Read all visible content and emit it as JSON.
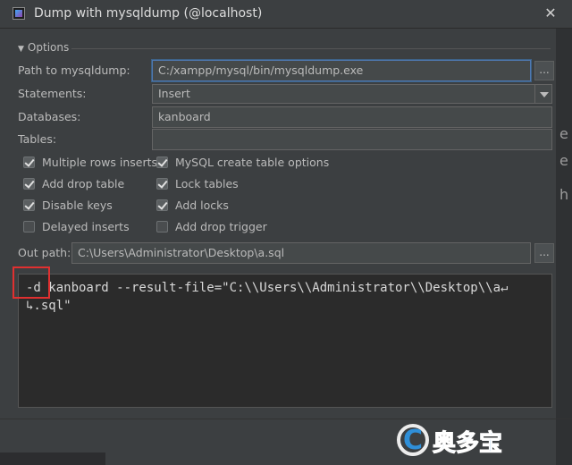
{
  "window": {
    "title": "Dump with mysqldump (@localhost)",
    "close_glyph": "✕"
  },
  "right_strip_chars": [
    "e",
    "e",
    "h"
  ],
  "options": {
    "header": "Options",
    "path_label": "Path to mysqldump:",
    "path_value": "C:/xampp/mysql/bin/mysqldump.exe",
    "statements_label": "Statements:",
    "statements_value": "Insert",
    "databases_label": "Databases:",
    "databases_value": "kanboard",
    "tables_label": "Tables:",
    "tables_value": "",
    "browse_glyph": "...",
    "checkboxes_left": [
      {
        "label": "Multiple rows inserts",
        "checked": true
      },
      {
        "label": "Add drop table",
        "checked": true
      },
      {
        "label": "Disable keys",
        "checked": true
      },
      {
        "label": "Delayed inserts",
        "checked": false
      }
    ],
    "checkboxes_right": [
      {
        "label": "MySQL create table options",
        "checked": true
      },
      {
        "label": "Lock tables",
        "checked": true
      },
      {
        "label": "Add locks",
        "checked": true
      },
      {
        "label": "Add drop trigger",
        "checked": false
      }
    ]
  },
  "out_path": {
    "label": "Out path:",
    "value": "C:\\Users\\Administrator\\Desktop\\a.sql"
  },
  "command": {
    "line1": "-d kanboard --result-file=\"C:\\\\Users\\\\Administrator\\\\Desktop\\\\a↵",
    "line2": "↳.sql\""
  },
  "watermark": {
    "text": "奥多宝",
    "letter": "C",
    "accent": "#2f8fd8"
  },
  "colors": {
    "accent_focus": "#4e79b3",
    "highlight": "#e03030"
  }
}
